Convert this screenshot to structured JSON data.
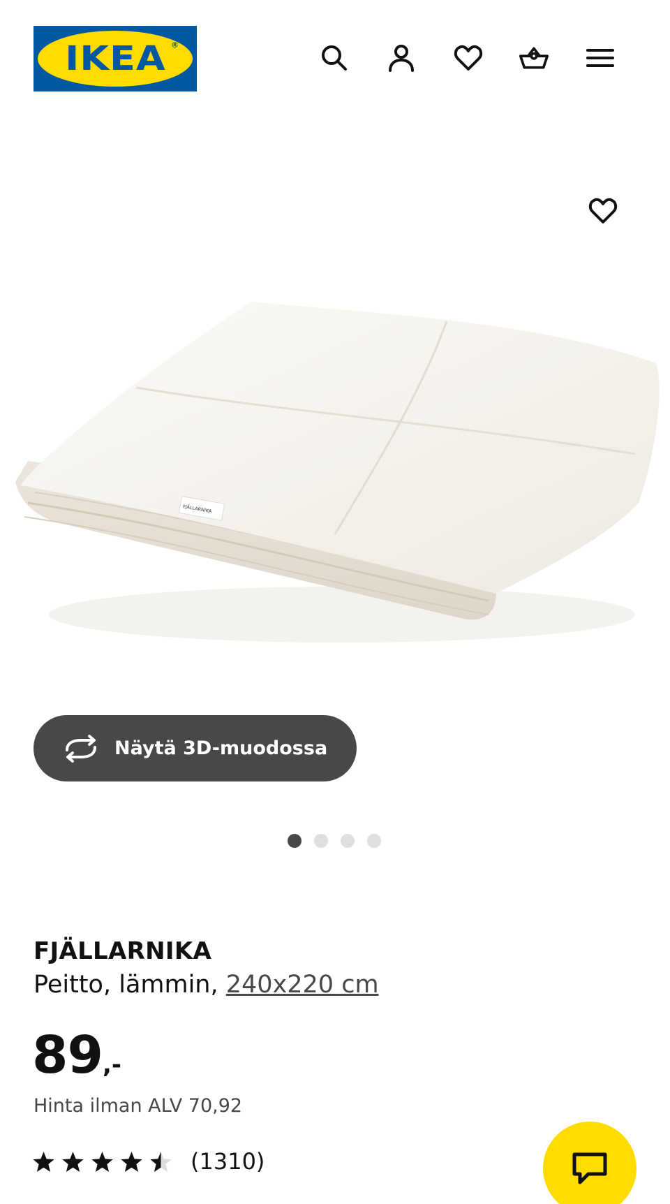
{
  "header": {
    "logo_text": "IKEA",
    "icons": [
      "search-icon",
      "user-icon",
      "heart-icon",
      "basket-icon",
      "menu-icon"
    ]
  },
  "gallery": {
    "favorite_icon": "heart-icon",
    "view3d_label": "Näytä 3D-muodossa",
    "slide_count": 4,
    "active_slide": 1,
    "product_label_text": "FJÄLLARNIKA"
  },
  "product": {
    "name": "FJÄLLARNIKA",
    "description_prefix": "Peitto, lämmin, ",
    "size": "240x220 cm",
    "price_amount": "89",
    "price_suffix": ",-",
    "price_excl_vat": "Hinta ilman ALV 70,92",
    "rating": 4.5,
    "review_count": "(1310)"
  },
  "colors": {
    "ikea_blue": "#0058a3",
    "ikea_yellow": "#ffdb00",
    "dark_button": "#484848"
  }
}
